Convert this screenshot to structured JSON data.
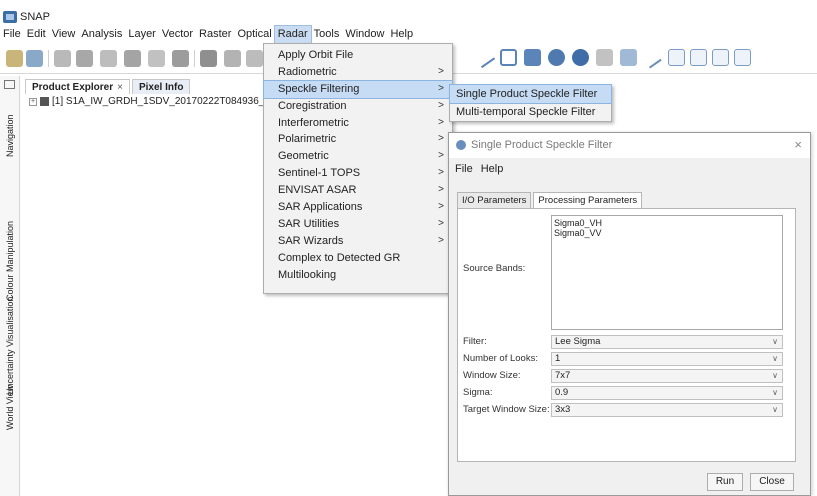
{
  "app": {
    "title": "SNAP"
  },
  "menubar": [
    "File",
    "Edit",
    "View",
    "Analysis",
    "Layer",
    "Vector",
    "Raster",
    "Optical",
    "Radar",
    "Tools",
    "Window",
    "Help"
  ],
  "active_menu": "Radar",
  "side_tabs": [
    "Navigation",
    "Colour Manipulation",
    "Uncertainty Visualisation",
    "World View"
  ],
  "explorer": {
    "tabs": [
      "Product Explorer",
      "Pixel Info"
    ],
    "close_glyph": "×",
    "products": [
      "[1] S1A_IW_GRDH_1SDV_20170222T084936_201"
    ]
  },
  "radar_menu": {
    "items": [
      {
        "label": "Apply Orbit File",
        "submenu": false
      },
      {
        "label": "Radiometric",
        "submenu": true
      },
      {
        "label": "Speckle Filtering",
        "submenu": true,
        "highlighted": true
      },
      {
        "label": "Coregistration",
        "submenu": true
      },
      {
        "label": "Interferometric",
        "submenu": true
      },
      {
        "label": "Polarimetric",
        "submenu": true
      },
      {
        "label": "Geometric",
        "submenu": true
      },
      {
        "label": "Sentinel-1 TOPS",
        "submenu": true
      },
      {
        "label": "ENVISAT ASAR",
        "submenu": true
      },
      {
        "label": "SAR Applications",
        "submenu": true
      },
      {
        "label": "SAR Utilities",
        "submenu": true
      },
      {
        "label": "SAR Wizards",
        "submenu": true
      },
      {
        "label": "Complex to Detected GR",
        "submenu": false
      },
      {
        "label": "Multilooking",
        "submenu": false
      }
    ],
    "arrow": ">"
  },
  "speckle_submenu": {
    "items": [
      {
        "label": "Single Product Speckle Filter",
        "highlighted": true
      },
      {
        "label": "Multi-temporal Speckle Filter",
        "highlighted": false
      }
    ]
  },
  "dialog": {
    "title": "Single Product Speckle Filter",
    "close": "×",
    "menu": [
      "File",
      "Help"
    ],
    "tabs": [
      "I/O Parameters",
      "Processing Parameters"
    ],
    "active_tab": "Processing Parameters",
    "source_bands_label": "Source Bands:",
    "source_bands": [
      "Sigma0_VH",
      "Sigma0_VV"
    ],
    "fields": [
      {
        "label": "Filter:",
        "value": "Lee Sigma"
      },
      {
        "label": "Number of Looks:",
        "value": "1"
      },
      {
        "label": "Window Size:",
        "value": "7x7"
      },
      {
        "label": "Sigma:",
        "value": "0.9"
      },
      {
        "label": "Target Window Size:",
        "value": "3x3"
      }
    ],
    "buttons": {
      "run": "Run",
      "close": "Close"
    }
  },
  "colors": {
    "accent": "#c6dcf5",
    "accent_border": "#8bb5e0"
  }
}
